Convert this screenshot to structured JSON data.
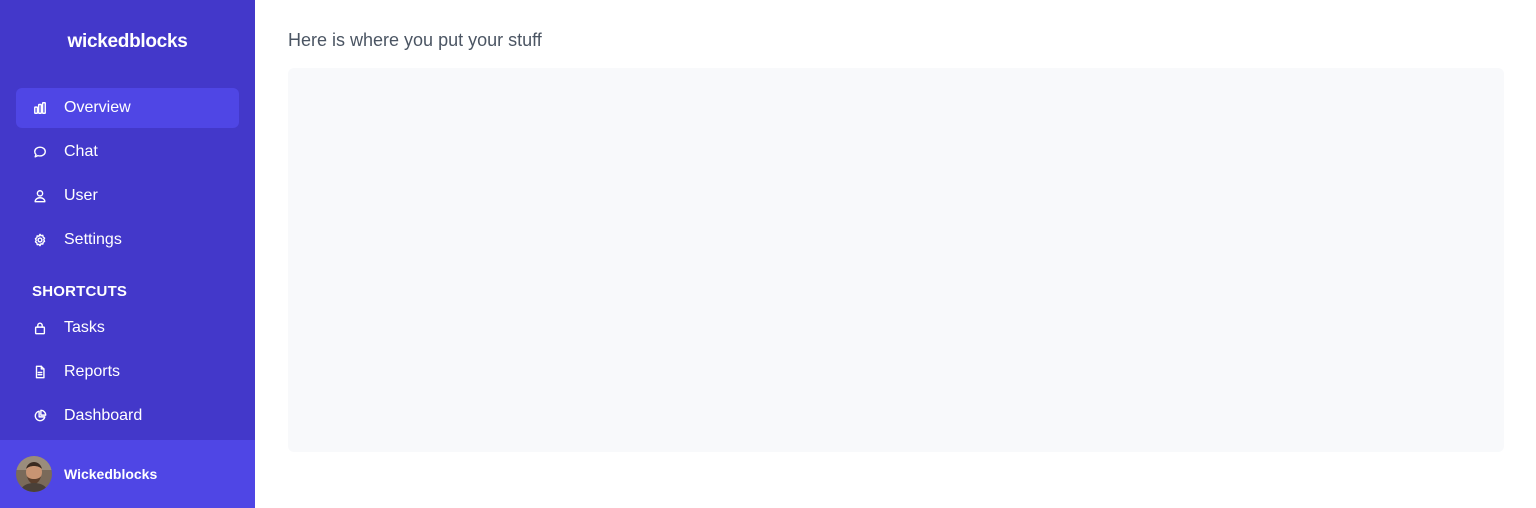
{
  "sidebar": {
    "brand": "wickedblocks",
    "items": [
      {
        "label": "Overview",
        "icon": "bar-chart-icon",
        "active": true
      },
      {
        "label": "Chat",
        "icon": "chat-bubble-icon"
      },
      {
        "label": "User",
        "icon": "user-icon"
      },
      {
        "label": "Settings",
        "icon": "gear-icon"
      }
    ],
    "shortcuts_label": "SHORTCUTS",
    "shortcuts": [
      {
        "label": "Tasks",
        "icon": "lock-icon"
      },
      {
        "label": "Reports",
        "icon": "document-icon"
      },
      {
        "label": "Dashboard",
        "icon": "pie-chart-icon"
      }
    ],
    "profile": {
      "name": "Wickedblocks"
    }
  },
  "main": {
    "title": "Here is where you put your stuff"
  },
  "colors": {
    "sidebar_bg": "#4338ca",
    "active_item_bg": "#4f46e5",
    "content_bg": "#f8f9fb"
  }
}
